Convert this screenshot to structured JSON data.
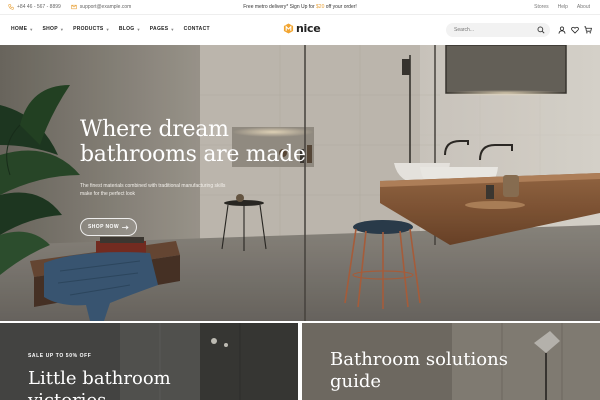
{
  "topbar": {
    "phone": "+84 46 - 567 - 8899",
    "email": "support@example.com",
    "promo_prefix": "Free metro delivery* Sign Up for ",
    "promo_highlight": "$20",
    "promo_suffix": " off your order!",
    "links": [
      "Stores",
      "Help",
      "About"
    ]
  },
  "nav": {
    "items": [
      "HOME",
      "SHOP",
      "PRODUCTS",
      "BLOG",
      "PAGES",
      "CONTACT"
    ],
    "has_dropdown": [
      true,
      true,
      true,
      true,
      true,
      false
    ]
  },
  "logo": {
    "text": "nice",
    "accent": "#f2a531"
  },
  "search": {
    "placeholder": "Search..."
  },
  "hero": {
    "title": "Where dream bathrooms are made",
    "subtitle": "The finest materials combined with traditional manufacturing skills make for the perfect look",
    "button": "SHOP NOW"
  },
  "cards": [
    {
      "eyebrow": "SALE UP TO 50% OFF",
      "title": "Little bathroom victories"
    },
    {
      "eyebrow": "",
      "title": "Bathroom solutions guide"
    }
  ],
  "icons": [
    "phone-icon",
    "mail-icon",
    "search-icon",
    "user-icon",
    "heart-icon",
    "cart-icon",
    "arrow-right-icon"
  ]
}
